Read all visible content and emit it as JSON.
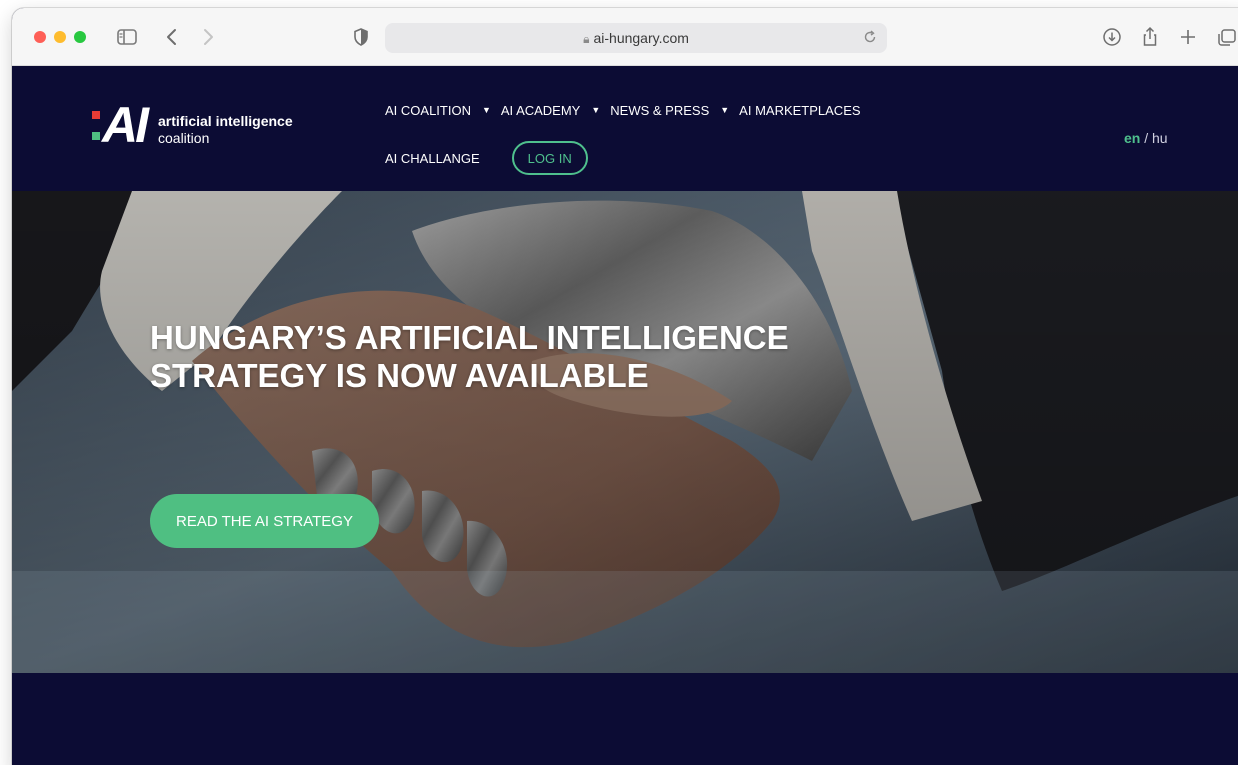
{
  "browser": {
    "url": "ai-hungary.com"
  },
  "site": {
    "logo": {
      "mark": "AI",
      "line1": "artificial intelligence",
      "line2": "coalition"
    },
    "nav": [
      {
        "label": "AI COALITION",
        "dropdown": true
      },
      {
        "label": "AI ACADEMY",
        "dropdown": true
      },
      {
        "label": "NEWS & PRESS",
        "dropdown": true
      },
      {
        "label": "AI MARKETPLACES",
        "dropdown": false
      },
      {
        "label": "AI CHALLANGE",
        "dropdown": false
      }
    ],
    "login_label": "LOG IN",
    "lang": {
      "active": "en",
      "separator": "/",
      "other": "hu"
    },
    "hero": {
      "title": "HUNGARY’S ARTIFICIAL INTELLIGENCE STRATEGY IS NOW AVAILABLE",
      "cta_label": "READ THE AI STRATEGY"
    }
  },
  "colors": {
    "brand_navy": "#0c0c34",
    "accent_green": "#4fbf82",
    "logo_red": "#e63b35"
  },
  "icons": [
    "sidebar-icon",
    "chevron-left-icon",
    "chevron-right-icon",
    "shield-icon",
    "lock-icon",
    "reload-icon",
    "download-icon",
    "share-icon",
    "plus-icon",
    "tabs-icon",
    "caret-down-icon"
  ]
}
